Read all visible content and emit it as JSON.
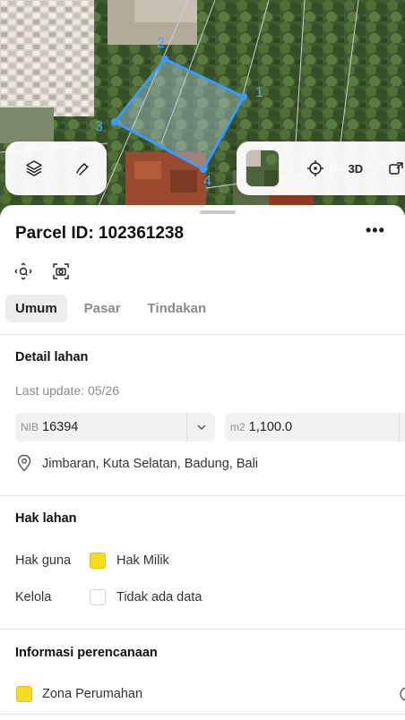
{
  "map": {
    "vertices": [
      "1",
      "2",
      "3",
      "4"
    ],
    "toolbar_right": {
      "btn_3d": "3D"
    }
  },
  "parcel": {
    "title": "Parcel ID: 102361238",
    "more": "•••"
  },
  "tabs": [
    {
      "label": "Umum"
    },
    {
      "label": "Pasar"
    },
    {
      "label": "Tindakan"
    }
  ],
  "detail": {
    "heading": "Detail lahan",
    "last_update": "Last update: 05/26",
    "nib_label": "NIB",
    "nib_value": "16394",
    "area_label": "m2",
    "area_value": "1,100.0",
    "address": "Jimbaran, Kuta Selatan, Badung, Bali"
  },
  "rights": {
    "heading": "Hak lahan",
    "hak_guna_label": "Hak guna",
    "hak_guna_value": "Hak Milik",
    "hak_guna_color": "#f5dc1e",
    "kelola_label": "Kelola",
    "kelola_value": "Tidak ada data"
  },
  "planning": {
    "heading": "Informasi perencanaan",
    "zone": "Zona Perumahan",
    "zone_color": "#f5dc1e"
  },
  "colors": {
    "accent": "#3a9bff",
    "swatch_yellow": "#f5dc1e"
  }
}
